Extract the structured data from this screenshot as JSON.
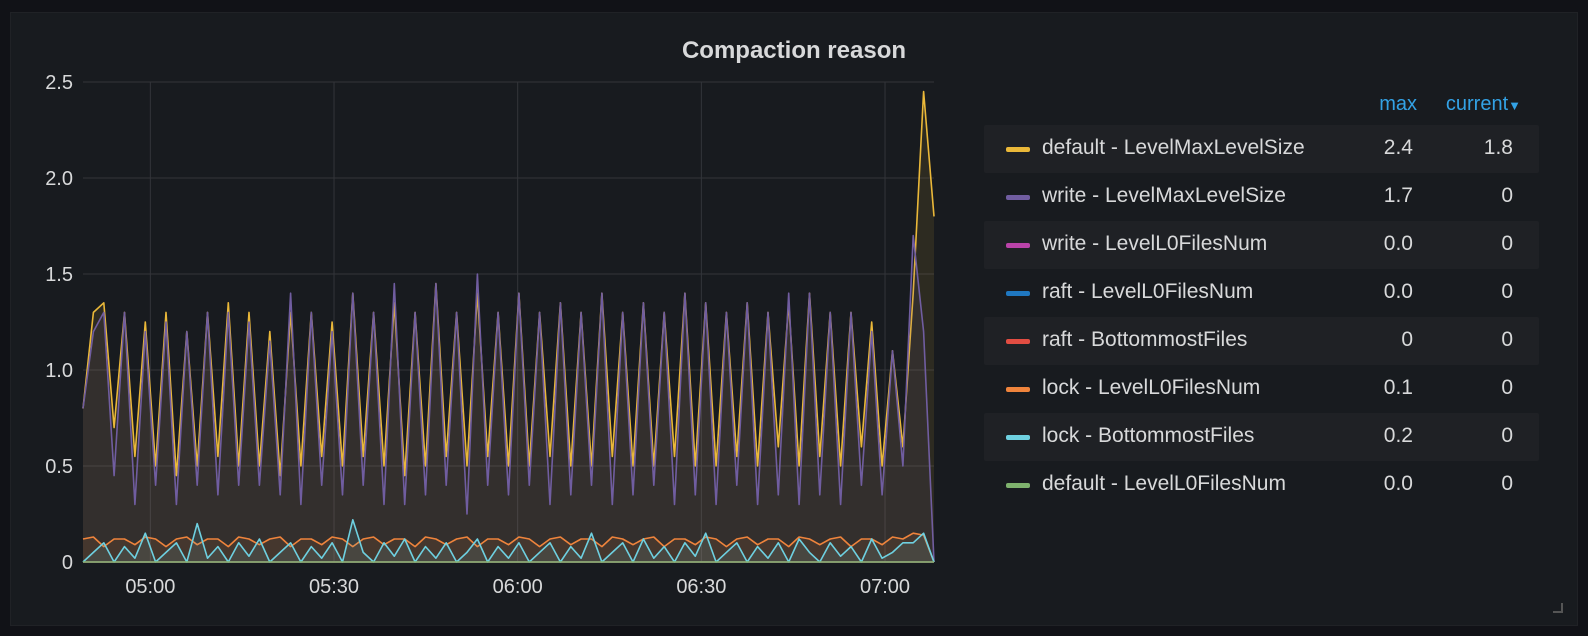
{
  "panel": {
    "title": "Compaction reason"
  },
  "legend": {
    "header_max": "max",
    "header_current": "current",
    "items": [
      {
        "name": "default - LevelMaxLevelSize",
        "max": "2.4",
        "current": "1.8",
        "color": "#eab839"
      },
      {
        "name": "write - LevelMaxLevelSize",
        "max": "1.7",
        "current": "0",
        "color": "#705da0"
      },
      {
        "name": "write - LevelL0FilesNum",
        "max": "0.0",
        "current": "0",
        "color": "#ba43a9"
      },
      {
        "name": "raft - LevelL0FilesNum",
        "max": "0.0",
        "current": "0",
        "color": "#1f78c1"
      },
      {
        "name": "raft - BottommostFiles",
        "max": "0",
        "current": "0",
        "color": "#e24d42"
      },
      {
        "name": "lock - LevelL0FilesNum",
        "max": "0.1",
        "current": "0",
        "color": "#ef843c"
      },
      {
        "name": "lock - BottommostFiles",
        "max": "0.2",
        "current": "0",
        "color": "#6ed0e0"
      },
      {
        "name": "default - LevelL0FilesNum",
        "max": "0.0",
        "current": "0",
        "color": "#7eb26d"
      }
    ]
  },
  "chart_data": {
    "type": "line",
    "xlabel": "",
    "ylabel": "",
    "ylim": [
      0,
      2.5
    ],
    "xlim": [
      "04:49",
      "07:08"
    ],
    "x_ticks": [
      "05:00",
      "05:30",
      "06:00",
      "06:30",
      "07:00"
    ],
    "y_ticks": [
      "0",
      "0.5",
      "1.0",
      "1.5",
      "2.0",
      "2.5"
    ],
    "grid": true,
    "legend_position": "right",
    "series": [
      {
        "name": "default - LevelMaxLevelSize",
        "color": "#eab839",
        "values": [
          0.8,
          1.3,
          1.35,
          0.7,
          1.3,
          0.55,
          1.25,
          0.5,
          1.3,
          0.45,
          1.2,
          0.5,
          1.3,
          0.55,
          1.35,
          0.5,
          1.3,
          0.5,
          1.2,
          0.45,
          1.3,
          0.5,
          1.3,
          0.55,
          1.25,
          0.5,
          1.4,
          0.55,
          1.3,
          0.5,
          1.35,
          0.45,
          1.3,
          0.5,
          1.45,
          0.55,
          1.3,
          0.5,
          1.4,
          0.55,
          1.3,
          0.5,
          1.4,
          0.5,
          1.3,
          0.55,
          1.35,
          0.5,
          1.3,
          0.5,
          1.4,
          0.55,
          1.3,
          0.5,
          1.35,
          0.5,
          1.3,
          0.55,
          1.4,
          0.5,
          1.35,
          0.5,
          1.3,
          0.55,
          1.35,
          0.5,
          1.3,
          0.6,
          1.35,
          0.5,
          1.4,
          0.55,
          1.3,
          0.5,
          1.3,
          0.6,
          1.25,
          0.5,
          1.1,
          0.6,
          1.4,
          2.45,
          1.8
        ]
      },
      {
        "name": "write - LevelMaxLevelSize",
        "color": "#705da0",
        "values": [
          0.8,
          1.2,
          1.3,
          0.45,
          1.3,
          0.3,
          1.2,
          0.4,
          1.25,
          0.3,
          1.2,
          0.4,
          1.3,
          0.35,
          1.3,
          0.4,
          1.25,
          0.4,
          1.15,
          0.35,
          1.4,
          0.3,
          1.3,
          0.4,
          1.2,
          0.35,
          1.4,
          0.4,
          1.3,
          0.3,
          1.45,
          0.3,
          1.3,
          0.35,
          1.45,
          0.4,
          1.3,
          0.25,
          1.5,
          0.4,
          1.3,
          0.35,
          1.4,
          0.4,
          1.3,
          0.3,
          1.35,
          0.35,
          1.3,
          0.4,
          1.4,
          0.3,
          1.3,
          0.35,
          1.35,
          0.4,
          1.3,
          0.3,
          1.4,
          0.35,
          1.35,
          0.3,
          1.3,
          0.4,
          1.35,
          0.3,
          1.3,
          0.35,
          1.4,
          0.3,
          1.4,
          0.35,
          1.3,
          0.3,
          1.3,
          0.4,
          1.2,
          0.35,
          1.1,
          0.5,
          1.7,
          1.2,
          0
        ]
      },
      {
        "name": "write - LevelL0FilesNum",
        "color": "#ba43a9",
        "values": [
          0,
          0,
          0,
          0,
          0,
          0,
          0,
          0,
          0,
          0,
          0,
          0,
          0,
          0,
          0,
          0,
          0,
          0,
          0,
          0,
          0,
          0,
          0,
          0,
          0,
          0,
          0,
          0,
          0,
          0,
          0,
          0,
          0,
          0,
          0,
          0,
          0,
          0,
          0,
          0,
          0,
          0,
          0,
          0,
          0,
          0,
          0,
          0,
          0,
          0,
          0,
          0,
          0,
          0,
          0,
          0,
          0,
          0,
          0,
          0,
          0,
          0,
          0,
          0,
          0,
          0,
          0,
          0,
          0,
          0,
          0,
          0,
          0,
          0,
          0,
          0,
          0,
          0,
          0,
          0,
          0,
          0,
          0
        ]
      },
      {
        "name": "raft - LevelL0FilesNum",
        "color": "#1f78c1",
        "values": [
          0,
          0,
          0,
          0,
          0,
          0,
          0,
          0,
          0,
          0,
          0,
          0,
          0,
          0,
          0,
          0,
          0,
          0,
          0,
          0,
          0,
          0,
          0,
          0,
          0,
          0,
          0,
          0,
          0,
          0,
          0,
          0,
          0,
          0,
          0,
          0,
          0,
          0,
          0,
          0,
          0,
          0,
          0,
          0,
          0,
          0,
          0,
          0,
          0,
          0,
          0,
          0,
          0,
          0,
          0,
          0,
          0,
          0,
          0,
          0,
          0,
          0,
          0,
          0,
          0,
          0,
          0,
          0,
          0,
          0,
          0,
          0,
          0,
          0,
          0,
          0,
          0,
          0,
          0,
          0,
          0,
          0,
          0
        ]
      },
      {
        "name": "raft - BottommostFiles",
        "color": "#e24d42",
        "values": [
          0,
          0,
          0,
          0,
          0,
          0,
          0,
          0,
          0,
          0,
          0,
          0,
          0,
          0,
          0,
          0,
          0,
          0,
          0,
          0,
          0,
          0,
          0,
          0,
          0,
          0,
          0,
          0,
          0,
          0,
          0,
          0,
          0,
          0,
          0,
          0,
          0,
          0,
          0,
          0,
          0,
          0,
          0,
          0,
          0,
          0,
          0,
          0,
          0,
          0,
          0,
          0,
          0,
          0,
          0,
          0,
          0,
          0,
          0,
          0,
          0,
          0,
          0,
          0,
          0,
          0,
          0,
          0,
          0,
          0,
          0,
          0,
          0,
          0,
          0,
          0,
          0,
          0,
          0,
          0,
          0,
          0,
          0
        ]
      },
      {
        "name": "lock - LevelL0FilesNum",
        "color": "#ef843c",
        "values": [
          0.12,
          0.13,
          0.08,
          0.12,
          0.12,
          0.09,
          0.13,
          0.12,
          0.08,
          0.12,
          0.13,
          0.09,
          0.12,
          0.12,
          0.08,
          0.13,
          0.12,
          0.09,
          0.12,
          0.13,
          0.08,
          0.12,
          0.12,
          0.09,
          0.13,
          0.12,
          0.08,
          0.12,
          0.13,
          0.09,
          0.12,
          0.12,
          0.08,
          0.13,
          0.12,
          0.09,
          0.12,
          0.13,
          0.08,
          0.12,
          0.12,
          0.09,
          0.13,
          0.12,
          0.08,
          0.12,
          0.13,
          0.09,
          0.12,
          0.12,
          0.08,
          0.13,
          0.12,
          0.09,
          0.12,
          0.13,
          0.08,
          0.12,
          0.12,
          0.09,
          0.13,
          0.12,
          0.08,
          0.12,
          0.13,
          0.09,
          0.12,
          0.12,
          0.08,
          0.13,
          0.12,
          0.09,
          0.12,
          0.13,
          0.08,
          0.12,
          0.12,
          0.09,
          0.13,
          0.12,
          0.15,
          0.14,
          0
        ]
      },
      {
        "name": "lock - BottommostFiles",
        "color": "#6ed0e0",
        "values": [
          0,
          0.05,
          0.1,
          0,
          0.08,
          0.02,
          0.15,
          0,
          0.05,
          0.1,
          0,
          0.2,
          0.02,
          0.08,
          0,
          0.1,
          0.03,
          0.12,
          0,
          0.05,
          0.1,
          0,
          0.08,
          0.02,
          0.1,
          0,
          0.22,
          0.05,
          0,
          0.1,
          0.03,
          0.12,
          0,
          0.08,
          0.02,
          0.1,
          0,
          0.05,
          0.12,
          0,
          0.08,
          0.02,
          0.1,
          0,
          0.05,
          0.1,
          0,
          0.08,
          0.02,
          0.15,
          0,
          0.05,
          0.1,
          0,
          0.12,
          0.02,
          0.08,
          0,
          0.1,
          0.03,
          0.15,
          0,
          0.05,
          0.1,
          0,
          0.08,
          0.02,
          0.1,
          0,
          0.12,
          0.05,
          0,
          0.1,
          0.03,
          0.08,
          0,
          0.12,
          0.02,
          0.05,
          0.1,
          0.1,
          0.15,
          0
        ]
      },
      {
        "name": "default - LevelL0FilesNum",
        "color": "#7eb26d",
        "values": [
          0,
          0,
          0,
          0,
          0,
          0,
          0,
          0,
          0,
          0,
          0,
          0,
          0,
          0,
          0,
          0,
          0,
          0,
          0,
          0,
          0,
          0,
          0,
          0,
          0,
          0,
          0,
          0,
          0,
          0,
          0,
          0,
          0,
          0,
          0,
          0,
          0,
          0,
          0,
          0,
          0,
          0,
          0,
          0,
          0,
          0,
          0,
          0,
          0,
          0,
          0,
          0,
          0,
          0,
          0,
          0,
          0,
          0,
          0,
          0,
          0,
          0,
          0,
          0,
          0,
          0,
          0,
          0,
          0,
          0,
          0,
          0,
          0,
          0,
          0,
          0,
          0,
          0,
          0,
          0,
          0,
          0,
          0
        ]
      }
    ]
  }
}
